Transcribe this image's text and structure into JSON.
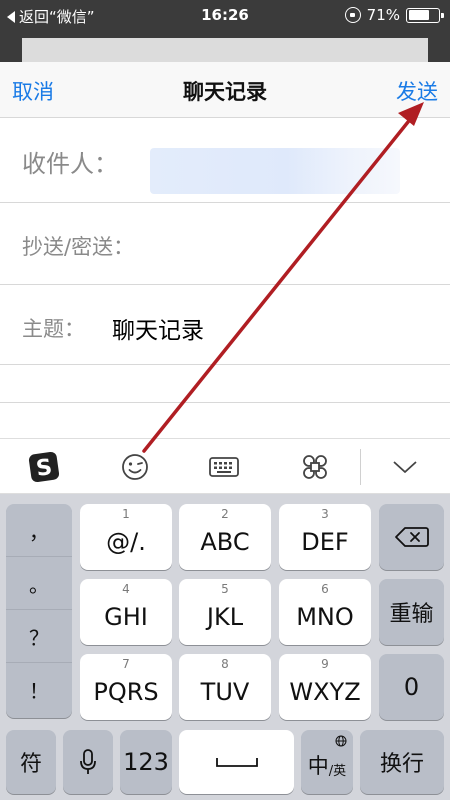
{
  "status_bar": {
    "back_label": "返回“微信”",
    "time": "16:26",
    "battery": "71%",
    "battery_level": 0.71
  },
  "nav": {
    "cancel": "取消",
    "title": "聊天记录",
    "send": "发送"
  },
  "fields": {
    "to_label": "收件人：",
    "cc_label": "抄送/密送：",
    "subject_label": "主题：",
    "subject_value": "聊天记录"
  },
  "keyboard": {
    "punct": [
      "，",
      "。",
      "？",
      "！"
    ],
    "rows": [
      [
        {
          "num": "1",
          "main": "@/."
        },
        {
          "num": "2",
          "main": "ABC"
        },
        {
          "num": "3",
          "main": "DEF"
        }
      ],
      [
        {
          "num": "4",
          "main": "GHI"
        },
        {
          "num": "5",
          "main": "JKL"
        },
        {
          "num": "6",
          "main": "MNO"
        }
      ],
      [
        {
          "num": "7",
          "main": "PQRS"
        },
        {
          "num": "8",
          "main": "TUV"
        },
        {
          "num": "9",
          "main": "WXYZ"
        }
      ]
    ],
    "reenter": "重输",
    "zero": "0",
    "symbol": "符",
    "num123": "123",
    "lang_main": "中",
    "lang_sub": "/英",
    "newline": "换行"
  },
  "colors": {
    "accent": "#1a7be6",
    "arrow": "#b01e23"
  },
  "icons": [
    "sogou-logo-icon",
    "emoji-icon",
    "keyboard-icon",
    "command-icon",
    "collapse-icon",
    "backspace-icon",
    "microphone-icon",
    "globe-icon",
    "space-icon",
    "annotation-arrow"
  ]
}
